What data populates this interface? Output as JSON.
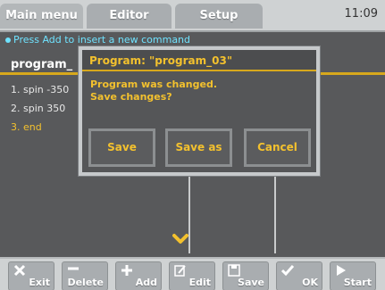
{
  "tabs": [
    "Main menu",
    "Editor",
    "Setup"
  ],
  "clock": "11:09",
  "hint": "Press Add to insert a new command",
  "program_header": "program_",
  "program_lines": [
    "1. spin -350",
    "2. spin 350",
    "3. end"
  ],
  "dialog": {
    "title": "Program: \"program_03\"",
    "message_line1": "Program was changed.",
    "message_line2": "Save changes?",
    "buttons": [
      "Save",
      "Save as",
      "Cancel"
    ]
  },
  "toolbar": [
    {
      "label": "Exit",
      "icon": "close-icon"
    },
    {
      "label": "Delete",
      "icon": "minus-icon"
    },
    {
      "label": "Add",
      "icon": "plus-icon"
    },
    {
      "label": "Edit",
      "icon": "edit-icon"
    },
    {
      "label": "Save",
      "icon": "floppy-icon"
    },
    {
      "label": "OK",
      "icon": "check-icon"
    },
    {
      "label": "Start",
      "icon": "play-icon"
    }
  ],
  "colors": {
    "accent": "#d7a81c",
    "dialog_text": "#f3c12e",
    "hint": "#6fe3ff"
  }
}
